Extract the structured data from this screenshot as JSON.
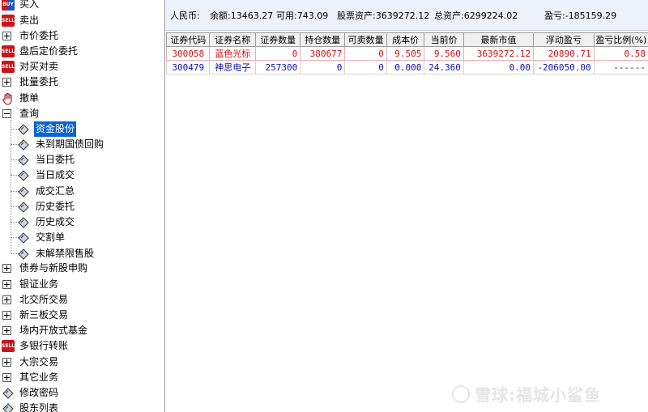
{
  "tree": {
    "items": [
      {
        "label": "买入",
        "icon": "buy-icon",
        "badge": "BUY"
      },
      {
        "label": "卖出",
        "icon": "sell-icon",
        "badge": "SELL"
      },
      {
        "label": "市价委托",
        "icon": "expand-icon"
      },
      {
        "label": "盘后定价委托",
        "icon": "sell-icon",
        "badge": "SELL"
      },
      {
        "label": "对买对卖",
        "icon": "buy-sell-icon",
        "badge": "SELL"
      },
      {
        "label": "批量委托",
        "icon": "expand-icon"
      },
      {
        "label": "撤单",
        "icon": "hand-icon"
      },
      {
        "label": "查询",
        "icon": "collapse-icon"
      },
      {
        "label": "资金股份",
        "icon": "diamond-icon",
        "selected": true
      },
      {
        "label": "未到期国债回购",
        "icon": "diamond-icon"
      },
      {
        "label": "当日委托",
        "icon": "diamond-icon"
      },
      {
        "label": "当日成交",
        "icon": "diamond-icon"
      },
      {
        "label": "成交汇总",
        "icon": "diamond-icon"
      },
      {
        "label": "历史委托",
        "icon": "diamond-icon"
      },
      {
        "label": "历史成交",
        "icon": "diamond-icon"
      },
      {
        "label": "交割单",
        "icon": "diamond-icon"
      },
      {
        "label": "未解禁限售股",
        "icon": "diamond-icon"
      },
      {
        "label": "债券与新股申购",
        "icon": "expand-icon"
      },
      {
        "label": "银证业务",
        "icon": "expand-icon"
      },
      {
        "label": "北交所交易",
        "icon": "expand-icon"
      },
      {
        "label": "新三板交易",
        "icon": "expand-icon"
      },
      {
        "label": "场内开放式基金",
        "icon": "expand-icon"
      },
      {
        "label": "多银行转账",
        "icon": "sell-icon",
        "badge": "SELL"
      },
      {
        "label": "大宗交易",
        "icon": "expand-icon"
      },
      {
        "label": "其它业务",
        "icon": "expand-icon"
      },
      {
        "label": "修改密码",
        "icon": "diamond-icon"
      },
      {
        "label": "股东列表",
        "icon": "diamond-icon"
      }
    ]
  },
  "summary": {
    "currency": "人民币:",
    "balance": "余额:13463.27",
    "available": "可用:743.09",
    "stock_assets": "股票资产:3639272.12",
    "total_assets": "总资产:6299224.02",
    "pnl": "盈亏:-185159.29"
  },
  "table": {
    "columns": [
      "证券代码",
      "证券名称",
      "证券数量",
      "持仓数量",
      "可卖数量",
      "成本价",
      "当前价",
      "最新市值",
      "浮动盈亏",
      "盈亏比例(%)"
    ],
    "rows": [
      [
        "300058",
        "蓝色光标",
        "0",
        "380677",
        "0",
        "9.505",
        "9.560",
        "3639272.12",
        "20890.71",
        "0.58"
      ],
      [
        "300479",
        "神思电子",
        "257300",
        "0",
        "0",
        "0.000",
        "24.360",
        "0.00",
        "-206050.00",
        "------"
      ]
    ]
  },
  "watermark": "雪球:福城小鲨鱼",
  "colors": {
    "selected_bg": "#0a64d8",
    "summary_bg": "#ecf1fb",
    "row_red": "#cc1111",
    "row_blue": "#1111aa",
    "badge_red": "#c8171b"
  }
}
